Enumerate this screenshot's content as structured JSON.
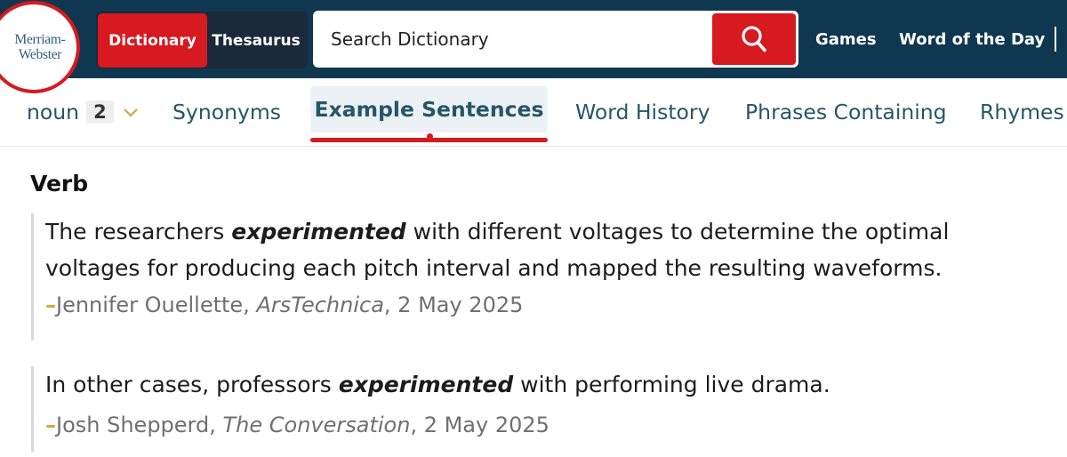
{
  "header": {
    "logo": {
      "line1": "Merriam-",
      "line2": "Webster"
    },
    "tabs": {
      "dictionary": "Dictionary",
      "thesaurus": "Thesaurus"
    },
    "search": {
      "placeholder": "Search Dictionary",
      "value": ""
    },
    "links": {
      "games": "Games",
      "word_of_day": "Word of the Day"
    }
  },
  "subnav": {
    "noun_label": "noun",
    "noun_count": "2",
    "items": [
      "Synonyms",
      "Example Sentences",
      "Word History",
      "Phrases Containing",
      "Rhymes"
    ],
    "active": "Example Sentences"
  },
  "content": {
    "section_heading": "Verb",
    "examples": [
      {
        "before": "The researchers ",
        "highlight": "experimented",
        "after": " with different voltages to determine the optimal voltages for producing each pitch interval and mapped the resulting waveforms.",
        "dash": "–",
        "author": "Jennifer Ouellette, ",
        "source": "ArsTechnica",
        "date": ", 2 May 2025"
      },
      {
        "before": "In other cases, professors ",
        "highlight": "experimented",
        "after": " with performing live drama.",
        "dash": "–",
        "author": "Josh Shepperd, ",
        "source": "The Conversation",
        "date": ", 2 May 2025"
      }
    ]
  },
  "colors": {
    "header_bg": "#0f3850",
    "brand_red": "#d71920",
    "link_teal": "#265667",
    "dash_gold": "#d3a93b"
  },
  "icons": {
    "search": "search-icon",
    "chevron": "chevron-down-icon"
  }
}
